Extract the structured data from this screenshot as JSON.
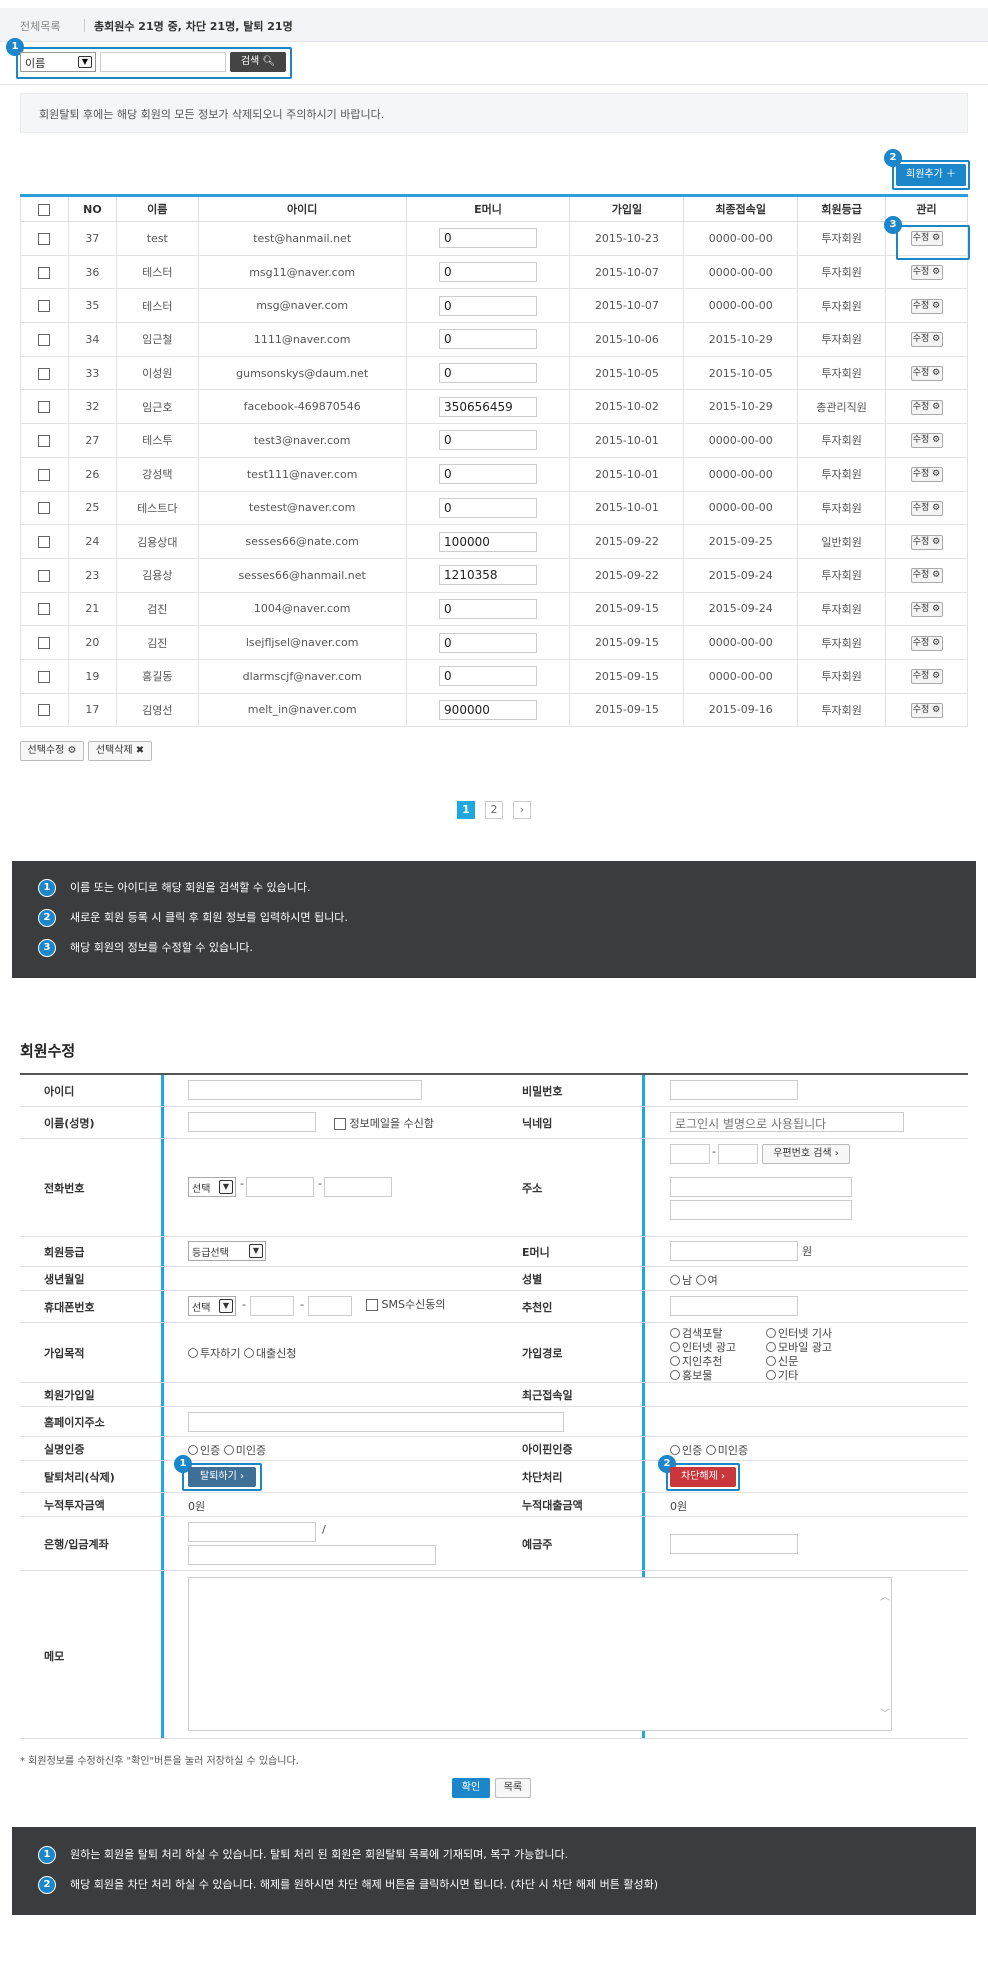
{
  "topbar": {
    "breadcrumb": "전체목록",
    "summary": "총회원수 21명 중, 차단 21명, 탈퇴 21명"
  },
  "search": {
    "select_value": "이름",
    "input_value": "",
    "button": "검색",
    "badge": "1"
  },
  "notice": "회원탈퇴 후에는 해당 회원의 모든 정보가 삭제되오니 주의하시기 바랍니다.",
  "add_button": {
    "label": "회원추가 ＋",
    "badge": "2"
  },
  "edit_badge": "3",
  "table": {
    "headers": [
      "",
      "NO",
      "이름",
      "아이디",
      "E머니",
      "가입일",
      "최종접속일",
      "회원등급",
      "관리"
    ],
    "edit_label": "수정 ⚙",
    "rows": [
      {
        "no": "37",
        "name": "test",
        "id": "test@hanmail.net",
        "emoney": "0",
        "join": "2015-10-23",
        "last": "0000-00-00",
        "grade": "투자회원"
      },
      {
        "no": "36",
        "name": "테스터",
        "id": "msg11@naver.com",
        "emoney": "0",
        "join": "2015-10-07",
        "last": "0000-00-00",
        "grade": "투자회원"
      },
      {
        "no": "35",
        "name": "테스터",
        "id": "msg@naver.com",
        "emoney": "0",
        "join": "2015-10-07",
        "last": "0000-00-00",
        "grade": "투자회원"
      },
      {
        "no": "34",
        "name": "임근철",
        "id": "1111@naver.com",
        "emoney": "0",
        "join": "2015-10-06",
        "last": "2015-10-29",
        "grade": "투자회원"
      },
      {
        "no": "33",
        "name": "이성원",
        "id": "gumsonskys@daum.net",
        "emoney": "0",
        "join": "2015-10-05",
        "last": "2015-10-05",
        "grade": "투자회원"
      },
      {
        "no": "32",
        "name": "임근호",
        "id": "facebook-469870546",
        "emoney": "350656459",
        "join": "2015-10-02",
        "last": "2015-10-29",
        "grade": "총관리직원"
      },
      {
        "no": "27",
        "name": "테스투",
        "id": "test3@naver.com",
        "emoney": "0",
        "join": "2015-10-01",
        "last": "0000-00-00",
        "grade": "투자회원"
      },
      {
        "no": "26",
        "name": "강성택",
        "id": "test111@naver.com",
        "emoney": "0",
        "join": "2015-10-01",
        "last": "0000-00-00",
        "grade": "투자회원"
      },
      {
        "no": "25",
        "name": "테스트다",
        "id": "testest@naver.com",
        "emoney": "0",
        "join": "2015-10-01",
        "last": "0000-00-00",
        "grade": "투자회원"
      },
      {
        "no": "24",
        "name": "김용상대",
        "id": "sesses66@nate.com",
        "emoney": "100000",
        "join": "2015-09-22",
        "last": "2015-09-25",
        "grade": "일반회원"
      },
      {
        "no": "23",
        "name": "김용상",
        "id": "sesses66@hanmail.net",
        "emoney": "1210358",
        "join": "2015-09-22",
        "last": "2015-09-24",
        "grade": "투자회원"
      },
      {
        "no": "21",
        "name": "검진",
        "id": "1004@naver.com",
        "emoney": "0",
        "join": "2015-09-15",
        "last": "2015-09-24",
        "grade": "투자회원"
      },
      {
        "no": "20",
        "name": "김진",
        "id": "lsejfljsel@naver.com",
        "emoney": "0",
        "join": "2015-09-15",
        "last": "0000-00-00",
        "grade": "투자회원"
      },
      {
        "no": "19",
        "name": "홍길동",
        "id": "dlarmscjf@naver.com",
        "emoney": "0",
        "join": "2015-09-15",
        "last": "0000-00-00",
        "grade": "투자회원"
      },
      {
        "no": "17",
        "name": "김영선",
        "id": "melt_in@naver.com",
        "emoney": "900000",
        "join": "2015-09-15",
        "last": "2015-09-16",
        "grade": "투자회원"
      }
    ]
  },
  "bulk": {
    "edit": "선택수정 ⚙",
    "delete": "선택삭제 ✖"
  },
  "pagination": {
    "pages": [
      "1",
      "2"
    ],
    "current": "1",
    "next": "›"
  },
  "help1": [
    {
      "n": "1",
      "text": "이름 또는 아이디로 해당 회원을 검색할 수 있습니다."
    },
    {
      "n": "2",
      "text": "새로운 회원 등록 시 클릭 후 회원 정보를 입력하시면 됩니다."
    },
    {
      "n": "3",
      "text": "해당 회원의 정보를 수정할 수 있습니다."
    }
  ],
  "form": {
    "title": "회원수정",
    "labels": {
      "id": "아이디",
      "password": "비밀번호",
      "name": "이름(성명)",
      "nickname": "닉네임",
      "phone": "전화번호",
      "address": "주소",
      "grade": "회원등급",
      "emoney": "E머니",
      "birth": "생년월일",
      "gender": "성별",
      "mobile": "휴대폰번호",
      "recommender": "추천인",
      "purpose": "가입목적",
      "route": "가입경로",
      "joindate": "회원가입일",
      "lastlogin": "최근접속일",
      "homepage": "홈페이지주소",
      "realname": "실명인증",
      "ipin": "아이핀인증",
      "withdraw": "탈퇴처리(삭제)",
      "block": "차단처리",
      "invest_total": "누적투자금액",
      "loan_total": "누적대출금액",
      "bank": "은행/입금계좌",
      "depositor": "예금주",
      "memo": "메모"
    },
    "mail_opt": "정보메일을 수신함",
    "nickname_placeholder": "로그인시 별명으로 사용됩니다",
    "phone_select": "선택",
    "zip_button": "우편번호 검색 ›",
    "grade_select": "등급선택",
    "emoney_unit": "원",
    "gender_opts": [
      "남",
      "여"
    ],
    "mobile_select": "선택",
    "sms_opt": "SMS수신동의",
    "purpose_opts": [
      "투자하기",
      "대출신청"
    ],
    "route_opts": [
      "검색포탈",
      "인터넷 기사",
      "인터넷 광고",
      "모바일 광고",
      "지인추천",
      "신문",
      "홍보물",
      "기타"
    ],
    "auth_opts": [
      "인증",
      "미인증"
    ],
    "withdraw_button": "탈퇴하기 ›",
    "block_button": "차단해제 ›",
    "invest_total_value": "0원",
    "loan_total_value": "0원",
    "dash": "-",
    "slash": "/"
  },
  "form_note": "* 회원정보를 수정하신후 \"확인\"버튼을 눌러 저장하실 수 있습니다.",
  "confirm_button": "확인",
  "list_button": "목록",
  "help2": [
    {
      "n": "1",
      "text": "원하는 회원을 탈퇴 처리 하실 수 있습니다. 탈퇴 처리 된 회원은 회원탈퇴 목록에 기재되며, 복구 가능합니다."
    },
    {
      "n": "2",
      "text": "해당 회원을 차단 처리 하실 수 있습니다. 해제를 원하시면 차단 해제 버튼을 클릭하시면 됩니다. (차단 시 차단 해제 버튼 활성화)"
    }
  ],
  "colors": {
    "accent": "#1b86c9",
    "danger": "#c9363c",
    "dark_panel": "#3b3c3e"
  }
}
